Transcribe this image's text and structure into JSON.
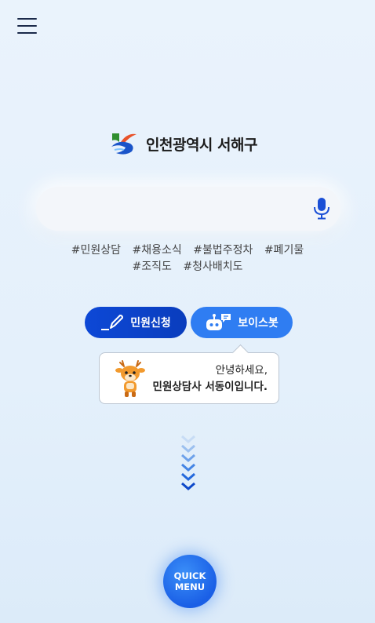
{
  "header": {
    "menu_icon": "hamburger-menu-icon"
  },
  "logo": {
    "text": "인천광역시 서해구",
    "colors": [
      "#2f8f2f",
      "#1a54c9",
      "#e8532b"
    ]
  },
  "search": {
    "value": "",
    "placeholder": "",
    "mic_icon": "microphone-icon",
    "mic_color": "#1a4fd6"
  },
  "tags": [
    "#민원상담",
    "#채용소식",
    "#불법주정차",
    "#폐기물",
    "#조직도",
    "#청사배치도"
  ],
  "buttons": {
    "apply": {
      "label": "민원신청",
      "icon": "pen-icon",
      "color": "#0d48d6"
    },
    "voicebot": {
      "label": "보이스봇",
      "icon": "robot-chat-icon",
      "color": "#2f7df2"
    }
  },
  "bubble": {
    "line1": "안녕하세요,",
    "line2": "민원상담사 서동이입니다.",
    "mascot": "deer-mascot"
  },
  "scroll": {
    "icon": "scroll-down-chevrons-icon"
  },
  "quick_menu": {
    "line1": "QUICK",
    "line2": "MENU"
  }
}
